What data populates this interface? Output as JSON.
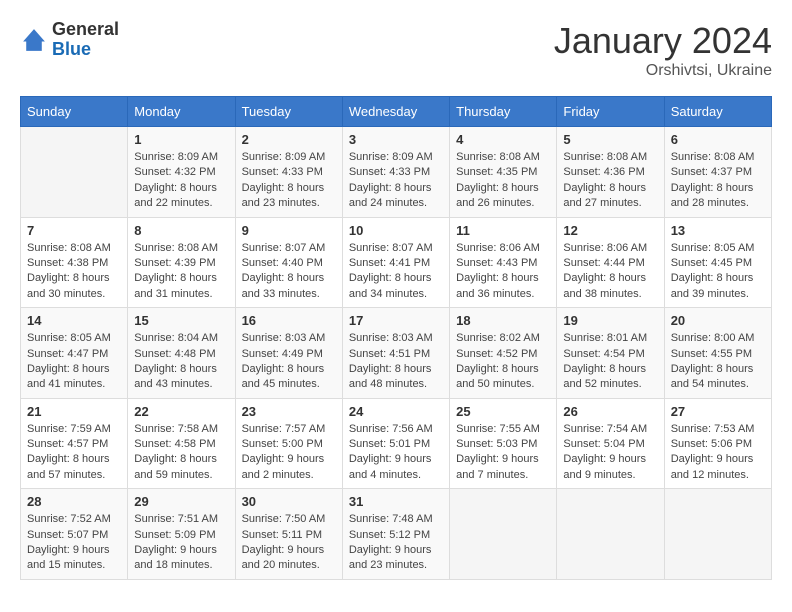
{
  "header": {
    "logo_general": "General",
    "logo_blue": "Blue",
    "month_title": "January 2024",
    "location": "Orshivtsi, Ukraine"
  },
  "weekdays": [
    "Sunday",
    "Monday",
    "Tuesday",
    "Wednesday",
    "Thursday",
    "Friday",
    "Saturday"
  ],
  "weeks": [
    [
      {
        "day": "",
        "sunrise": "",
        "sunset": "",
        "daylight": ""
      },
      {
        "day": "1",
        "sunrise": "Sunrise: 8:09 AM",
        "sunset": "Sunset: 4:32 PM",
        "daylight": "Daylight: 8 hours and 22 minutes."
      },
      {
        "day": "2",
        "sunrise": "Sunrise: 8:09 AM",
        "sunset": "Sunset: 4:33 PM",
        "daylight": "Daylight: 8 hours and 23 minutes."
      },
      {
        "day": "3",
        "sunrise": "Sunrise: 8:09 AM",
        "sunset": "Sunset: 4:33 PM",
        "daylight": "Daylight: 8 hours and 24 minutes."
      },
      {
        "day": "4",
        "sunrise": "Sunrise: 8:08 AM",
        "sunset": "Sunset: 4:35 PM",
        "daylight": "Daylight: 8 hours and 26 minutes."
      },
      {
        "day": "5",
        "sunrise": "Sunrise: 8:08 AM",
        "sunset": "Sunset: 4:36 PM",
        "daylight": "Daylight: 8 hours and 27 minutes."
      },
      {
        "day": "6",
        "sunrise": "Sunrise: 8:08 AM",
        "sunset": "Sunset: 4:37 PM",
        "daylight": "Daylight: 8 hours and 28 minutes."
      }
    ],
    [
      {
        "day": "7",
        "sunrise": "Sunrise: 8:08 AM",
        "sunset": "Sunset: 4:38 PM",
        "daylight": "Daylight: 8 hours and 30 minutes."
      },
      {
        "day": "8",
        "sunrise": "Sunrise: 8:08 AM",
        "sunset": "Sunset: 4:39 PM",
        "daylight": "Daylight: 8 hours and 31 minutes."
      },
      {
        "day": "9",
        "sunrise": "Sunrise: 8:07 AM",
        "sunset": "Sunset: 4:40 PM",
        "daylight": "Daylight: 8 hours and 33 minutes."
      },
      {
        "day": "10",
        "sunrise": "Sunrise: 8:07 AM",
        "sunset": "Sunset: 4:41 PM",
        "daylight": "Daylight: 8 hours and 34 minutes."
      },
      {
        "day": "11",
        "sunrise": "Sunrise: 8:06 AM",
        "sunset": "Sunset: 4:43 PM",
        "daylight": "Daylight: 8 hours and 36 minutes."
      },
      {
        "day": "12",
        "sunrise": "Sunrise: 8:06 AM",
        "sunset": "Sunset: 4:44 PM",
        "daylight": "Daylight: 8 hours and 38 minutes."
      },
      {
        "day": "13",
        "sunrise": "Sunrise: 8:05 AM",
        "sunset": "Sunset: 4:45 PM",
        "daylight": "Daylight: 8 hours and 39 minutes."
      }
    ],
    [
      {
        "day": "14",
        "sunrise": "Sunrise: 8:05 AM",
        "sunset": "Sunset: 4:47 PM",
        "daylight": "Daylight: 8 hours and 41 minutes."
      },
      {
        "day": "15",
        "sunrise": "Sunrise: 8:04 AM",
        "sunset": "Sunset: 4:48 PM",
        "daylight": "Daylight: 8 hours and 43 minutes."
      },
      {
        "day": "16",
        "sunrise": "Sunrise: 8:03 AM",
        "sunset": "Sunset: 4:49 PM",
        "daylight": "Daylight: 8 hours and 45 minutes."
      },
      {
        "day": "17",
        "sunrise": "Sunrise: 8:03 AM",
        "sunset": "Sunset: 4:51 PM",
        "daylight": "Daylight: 8 hours and 48 minutes."
      },
      {
        "day": "18",
        "sunrise": "Sunrise: 8:02 AM",
        "sunset": "Sunset: 4:52 PM",
        "daylight": "Daylight: 8 hours and 50 minutes."
      },
      {
        "day": "19",
        "sunrise": "Sunrise: 8:01 AM",
        "sunset": "Sunset: 4:54 PM",
        "daylight": "Daylight: 8 hours and 52 minutes."
      },
      {
        "day": "20",
        "sunrise": "Sunrise: 8:00 AM",
        "sunset": "Sunset: 4:55 PM",
        "daylight": "Daylight: 8 hours and 54 minutes."
      }
    ],
    [
      {
        "day": "21",
        "sunrise": "Sunrise: 7:59 AM",
        "sunset": "Sunset: 4:57 PM",
        "daylight": "Daylight: 8 hours and 57 minutes."
      },
      {
        "day": "22",
        "sunrise": "Sunrise: 7:58 AM",
        "sunset": "Sunset: 4:58 PM",
        "daylight": "Daylight: 8 hours and 59 minutes."
      },
      {
        "day": "23",
        "sunrise": "Sunrise: 7:57 AM",
        "sunset": "Sunset: 5:00 PM",
        "daylight": "Daylight: 9 hours and 2 minutes."
      },
      {
        "day": "24",
        "sunrise": "Sunrise: 7:56 AM",
        "sunset": "Sunset: 5:01 PM",
        "daylight": "Daylight: 9 hours and 4 minutes."
      },
      {
        "day": "25",
        "sunrise": "Sunrise: 7:55 AM",
        "sunset": "Sunset: 5:03 PM",
        "daylight": "Daylight: 9 hours and 7 minutes."
      },
      {
        "day": "26",
        "sunrise": "Sunrise: 7:54 AM",
        "sunset": "Sunset: 5:04 PM",
        "daylight": "Daylight: 9 hours and 9 minutes."
      },
      {
        "day": "27",
        "sunrise": "Sunrise: 7:53 AM",
        "sunset": "Sunset: 5:06 PM",
        "daylight": "Daylight: 9 hours and 12 minutes."
      }
    ],
    [
      {
        "day": "28",
        "sunrise": "Sunrise: 7:52 AM",
        "sunset": "Sunset: 5:07 PM",
        "daylight": "Daylight: 9 hours and 15 minutes."
      },
      {
        "day": "29",
        "sunrise": "Sunrise: 7:51 AM",
        "sunset": "Sunset: 5:09 PM",
        "daylight": "Daylight: 9 hours and 18 minutes."
      },
      {
        "day": "30",
        "sunrise": "Sunrise: 7:50 AM",
        "sunset": "Sunset: 5:11 PM",
        "daylight": "Daylight: 9 hours and 20 minutes."
      },
      {
        "day": "31",
        "sunrise": "Sunrise: 7:48 AM",
        "sunset": "Sunset: 5:12 PM",
        "daylight": "Daylight: 9 hours and 23 minutes."
      },
      {
        "day": "",
        "sunrise": "",
        "sunset": "",
        "daylight": ""
      },
      {
        "day": "",
        "sunrise": "",
        "sunset": "",
        "daylight": ""
      },
      {
        "day": "",
        "sunrise": "",
        "sunset": "",
        "daylight": ""
      }
    ]
  ]
}
